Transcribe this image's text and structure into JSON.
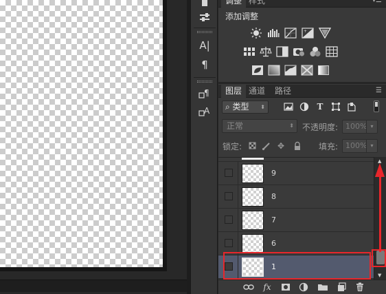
{
  "panel": {
    "top_tabs": [
      "调整",
      "样式"
    ],
    "adjustments_title": "添加调整",
    "adjustment_icons": [
      [
        "brightness-contrast-icon",
        "levels-icon",
        "curves-icon",
        "exposure-icon",
        "vibrance-icon"
      ],
      [
        "hue-saturation-icon",
        "color-balance-icon",
        "black-white-icon",
        "photo-filter-icon",
        "channel-mixer-icon",
        "color-lookup-icon"
      ],
      [
        "invert-icon",
        "posterize-icon",
        "threshold-icon",
        "selective-color-icon",
        "gradient-map-icon"
      ]
    ],
    "layers_tabs": [
      "图层",
      "通道",
      "路径"
    ],
    "filter_label": "类型",
    "blend_mode": "正常",
    "opacity_label": "不透明度:",
    "opacity_value": "100%",
    "lock_label": "锁定:",
    "fill_label": "填充:",
    "fill_value": "100%",
    "layers": [
      {
        "name": "9",
        "selected": false
      },
      {
        "name": "8",
        "selected": false
      },
      {
        "name": "7",
        "selected": false
      },
      {
        "name": "6",
        "selected": false
      },
      {
        "name": "1",
        "selected": true
      }
    ]
  },
  "tools": {
    "character_glyph": "A|",
    "paragraph_glyph": "¶"
  },
  "annotation": {
    "color": "#e8262b",
    "selected_layer_color": "#535a6e"
  }
}
